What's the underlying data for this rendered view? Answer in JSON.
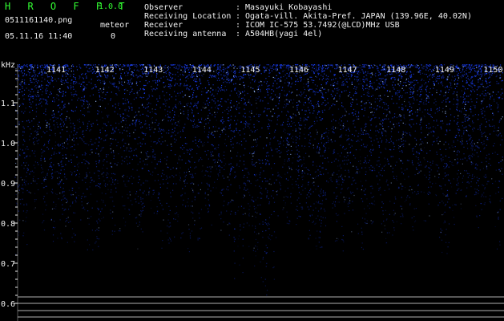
{
  "app": {
    "name": "H R O F F T",
    "version": "1.0.0",
    "filename": "0511161140.png",
    "timestamp": "05.11.16 11:40",
    "meteor_label": "meteor",
    "meteor_count": "0"
  },
  "metadata": [
    {
      "key": "Observer",
      "sep": ":",
      "value": "Masayuki Kobayashi"
    },
    {
      "key": "Receiving Location",
      "sep": ":",
      "value": "Ogata-vill. Akita-Pref. JAPAN (139.96E, 40.02N)"
    },
    {
      "key": "Receiver",
      "sep": ":",
      "value": "ICOM IC-575 53.7492(@LCD)MHz USB"
    },
    {
      "key": "Receiving antenna",
      "sep": ":",
      "value": "A504HB(yagi 4el)"
    }
  ],
  "spectrogram": {
    "y_unit": "kHz",
    "y_ticks": [
      "1.1",
      "1.0",
      "0.9",
      "0.8",
      "0.7",
      "0.6"
    ],
    "time_labels": [
      "1141",
      "1142",
      "1143",
      "1144",
      "1145",
      "1146",
      "1147",
      "1148",
      "1149",
      "1150"
    ],
    "colors": {
      "background": "#000000",
      "signal": "#1a40ff",
      "highlight": "#9fc0ff",
      "text": "#f2f2f2",
      "baseline": "#cfcfcf",
      "brand": "#33ff33"
    }
  }
}
